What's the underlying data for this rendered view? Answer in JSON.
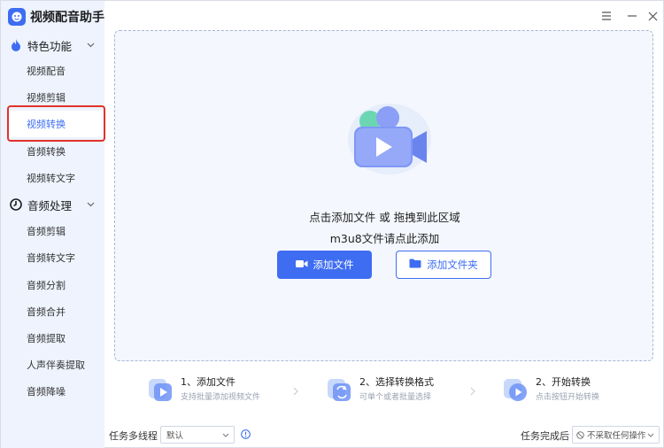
{
  "app": {
    "title": "视频配音助手"
  },
  "sidebar": {
    "groups": [
      {
        "label": "特色功能",
        "icon": "flame-icon",
        "items": [
          {
            "label": "视频配音"
          },
          {
            "label": "视频剪辑"
          },
          {
            "label": "视频转换",
            "active": true
          },
          {
            "label": "音频转换"
          },
          {
            "label": "视频转文字"
          }
        ]
      },
      {
        "label": "音频处理",
        "icon": "audio-clock-icon",
        "items": [
          {
            "label": "音频剪辑"
          },
          {
            "label": "音频转文字"
          },
          {
            "label": "音频分割"
          },
          {
            "label": "音频合并"
          },
          {
            "label": "音频提取"
          },
          {
            "label": "人声伴奏提取"
          },
          {
            "label": "音频降噪"
          }
        ]
      }
    ]
  },
  "dropzone": {
    "line1": "点击添加文件 或 拖拽到此区域",
    "line2": "m3u8文件请点此添加",
    "add_file_label": "添加文件",
    "add_folder_label": "添加文件夹"
  },
  "steps": [
    {
      "title": "1、添加文件",
      "desc": "支持批量添加视频文件"
    },
    {
      "title": "2、选择转换格式",
      "desc": "可单个或者批量选择"
    },
    {
      "title": "2、开始转换",
      "desc": "点击按钮开始转换"
    }
  ],
  "bottom": {
    "threads_label": "任务多线程",
    "threads_value": "默认",
    "after_label": "任务完成后",
    "after_value": "不采取任何操作"
  },
  "colors": {
    "accent": "#3e6df2",
    "sidebar_bg": "#eef3fd",
    "highlight": "#e2312a"
  }
}
